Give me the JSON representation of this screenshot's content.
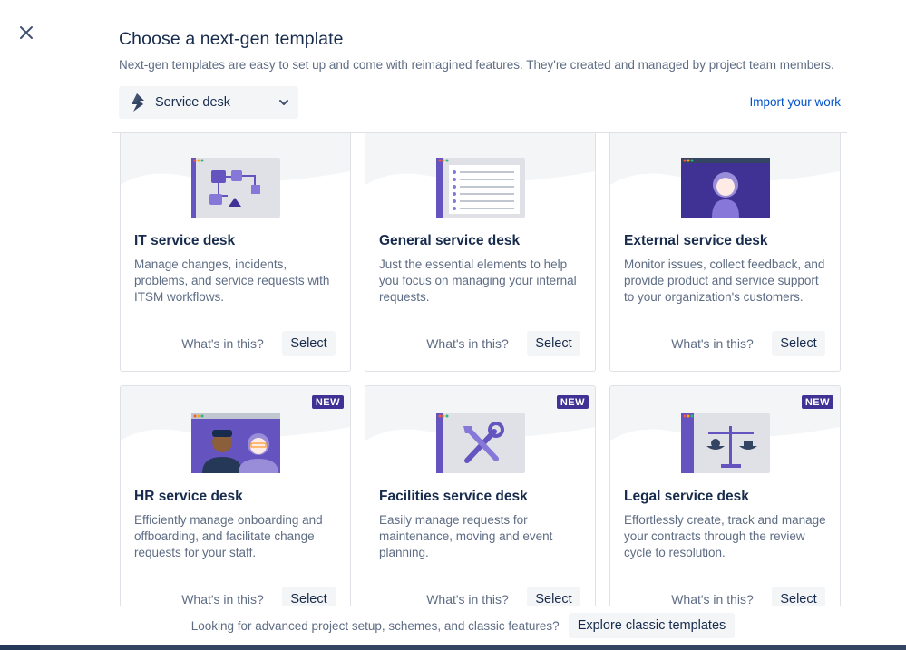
{
  "dialog": {
    "title": "Choose a next-gen template",
    "subtitle": "Next-gen templates are easy to set up and come with reimagined features. They're created and managed by project team members."
  },
  "type_selector": {
    "selected": "Service desk",
    "icon": "lightning-bolt-icon"
  },
  "import_link": "Import your work",
  "templates": [
    {
      "name": "IT service desk",
      "description": "Manage changes, incidents, problems, and service requests with ITSM workflows.",
      "whats_in": "What's in this?",
      "select": "Select",
      "illustration": "workflow-diagram-icon",
      "badge": ""
    },
    {
      "name": "General service desk",
      "description": "Just the essential elements to help you focus on managing your internal requests.",
      "whats_in": "What's in this?",
      "select": "Select",
      "illustration": "checklist-icon",
      "badge": ""
    },
    {
      "name": "External service desk",
      "description": "Monitor issues, collect feedback, and provide product and service support to your organization's customers.",
      "whats_in": "What's in this?",
      "select": "Select",
      "illustration": "customer-avatar-icon",
      "badge": ""
    },
    {
      "name": "HR service desk",
      "description": "Efficiently manage onboarding and offboarding, and facilitate change requests for your staff.",
      "whats_in": "What's in this?",
      "select": "Select",
      "illustration": "people-icon",
      "badge": "NEW"
    },
    {
      "name": "Facilities service desk",
      "description": "Easily manage requests for maintenance, moving and event planning.",
      "whats_in": "What's in this?",
      "select": "Select",
      "illustration": "tools-icon",
      "badge": "NEW"
    },
    {
      "name": "Legal service desk",
      "description": "Effortlessly create, track and manage your contracts through the review cycle to resolution.",
      "whats_in": "What's in this?",
      "select": "Select",
      "illustration": "scales-icon",
      "badge": "NEW"
    }
  ],
  "footer": {
    "message": "Looking for advanced project setup, schemes, and classic features?",
    "button": "Explore classic templates"
  },
  "colors": {
    "brand_purple": "#6554C0",
    "dark_purple": "#403294",
    "link_blue": "#0052CC",
    "text": "#172B4D",
    "subtle_text": "#5E6C84"
  }
}
